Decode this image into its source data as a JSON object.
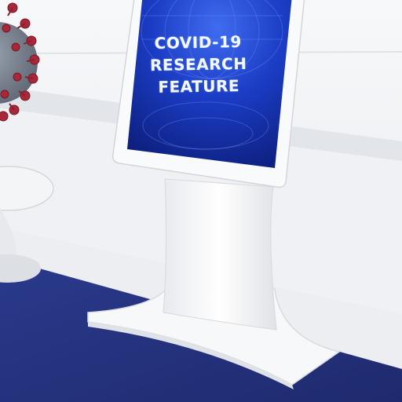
{
  "kiosk_screen": {
    "headline_lines": [
      "COVID-19",
      "RESEARCH",
      "FEATURE"
    ]
  },
  "colors": {
    "floor": "#24307a",
    "wall": "#f2f3f5",
    "screen_blue": "#1a36b8",
    "virus_red": "#a8283a"
  },
  "icons": {
    "virus": "coronavirus-particle"
  }
}
